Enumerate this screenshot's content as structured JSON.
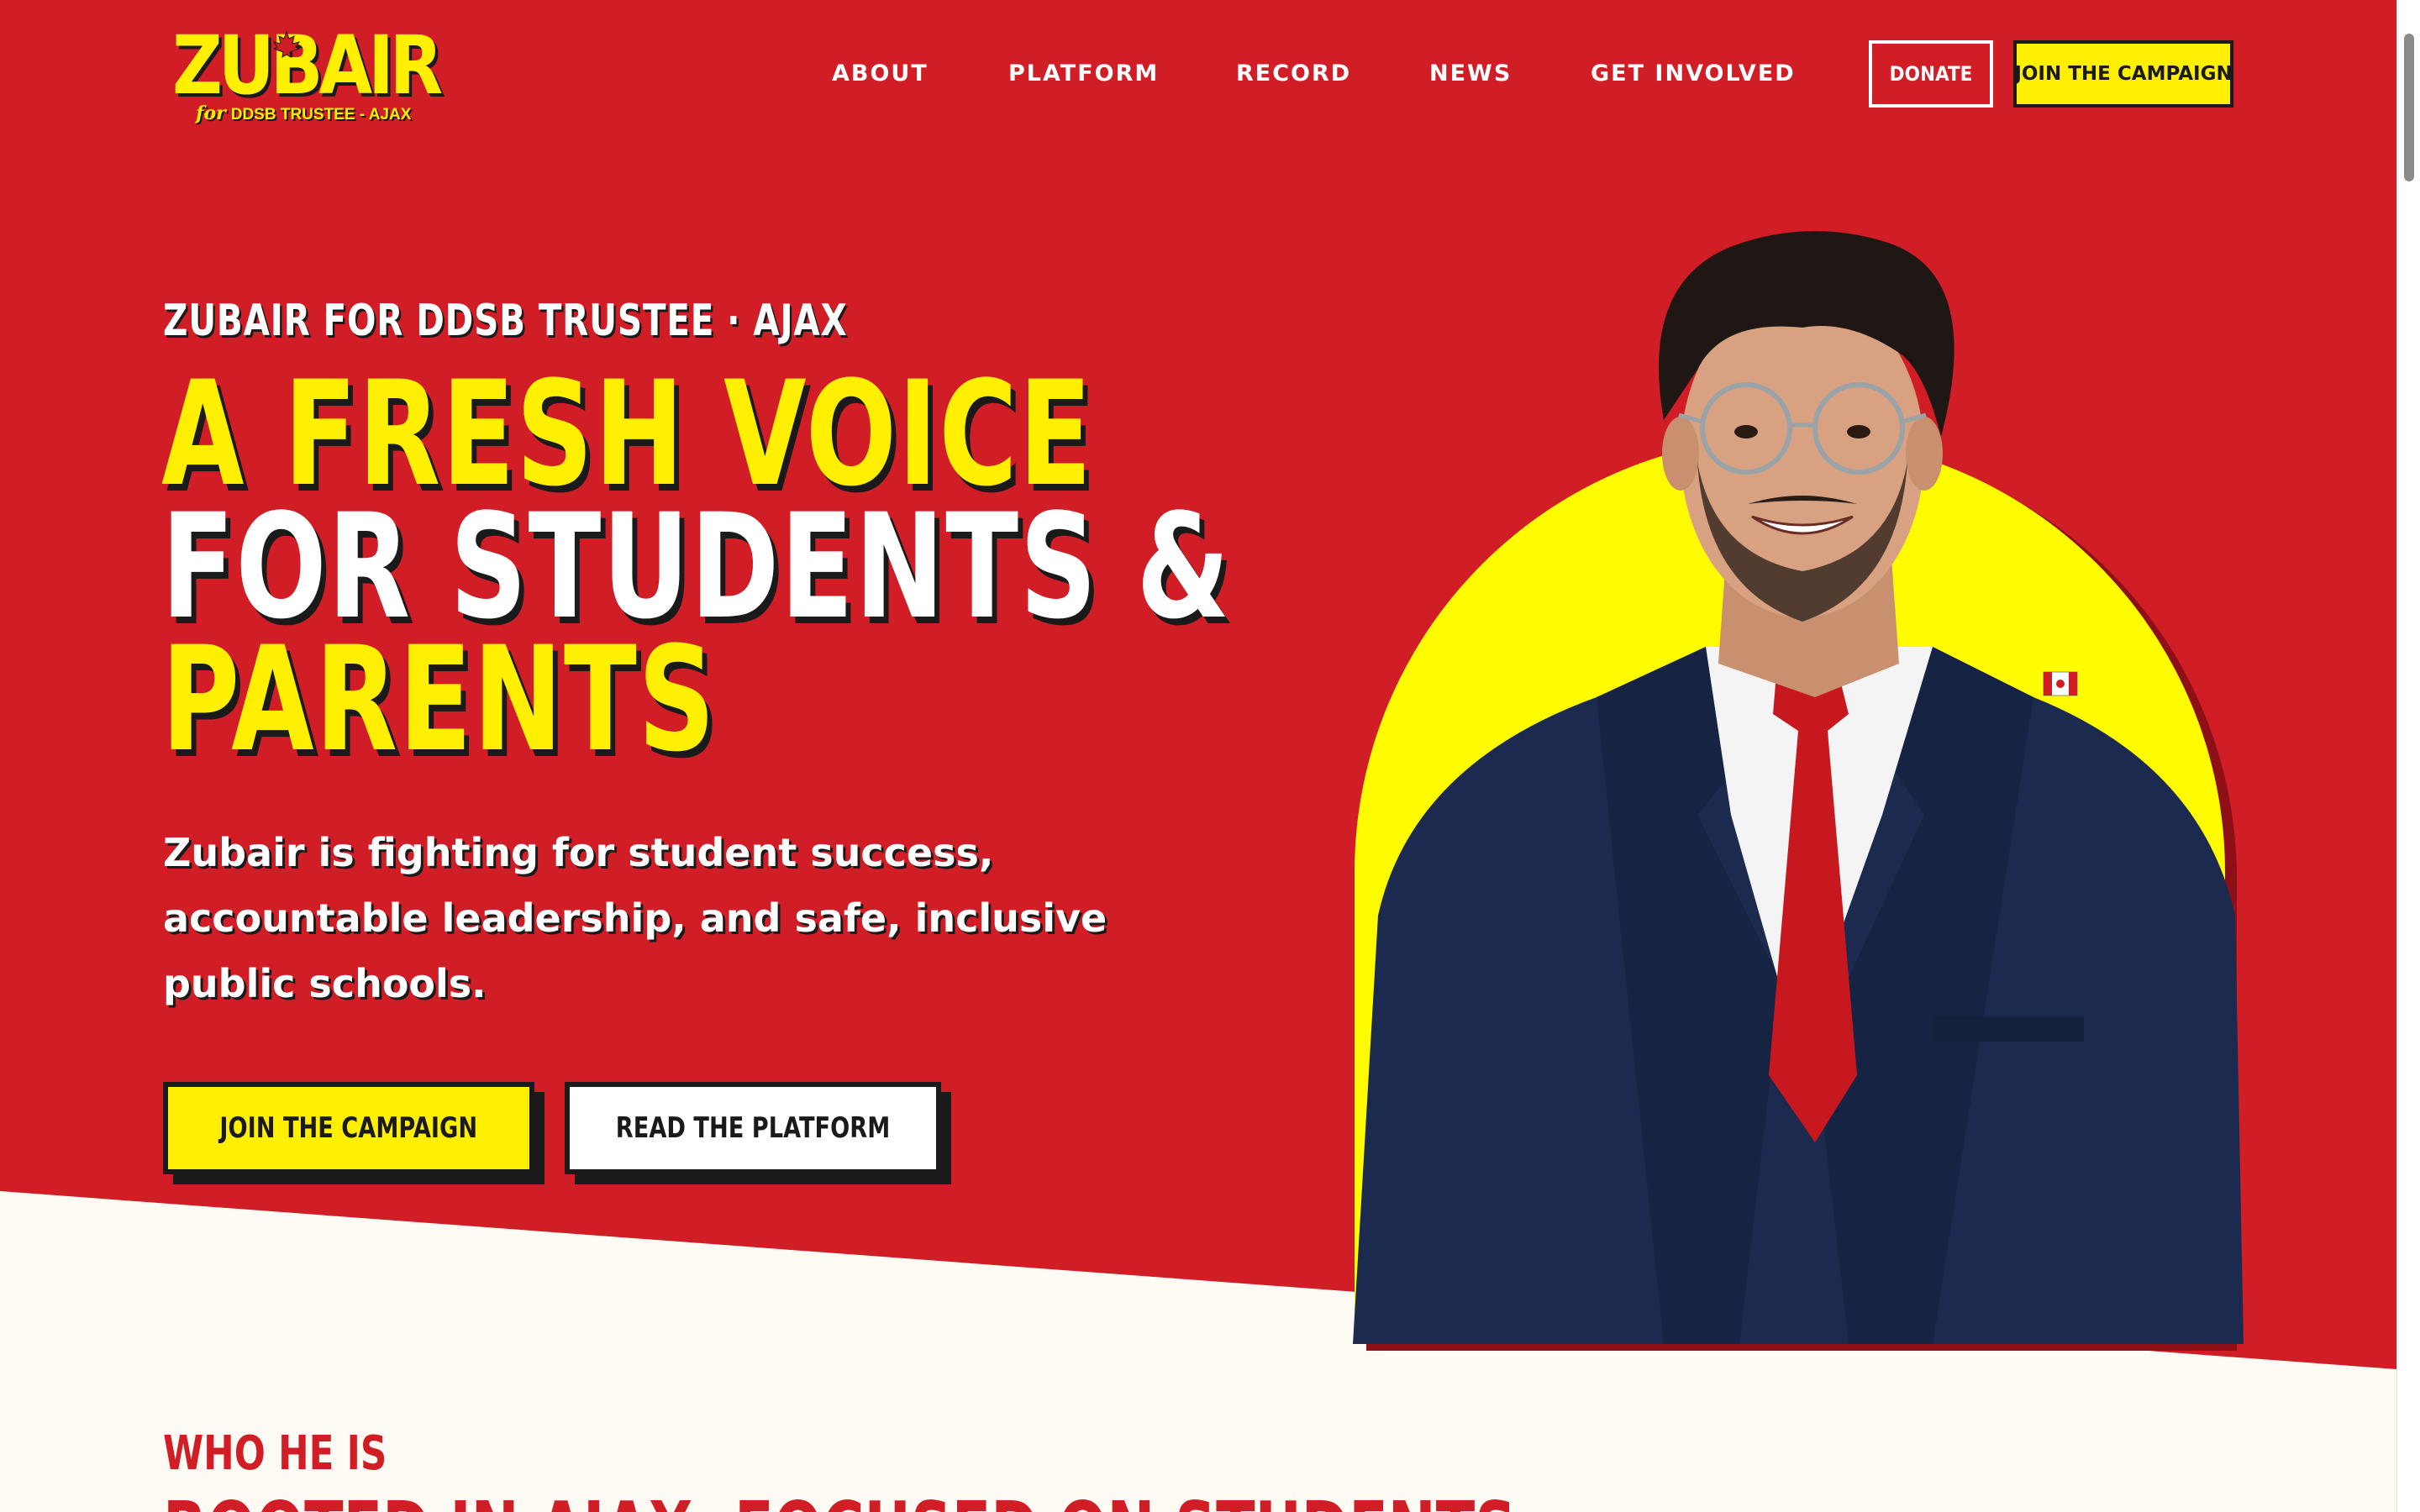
{
  "brand": {
    "logo_word": "ZUBAIR",
    "logo_for": "for",
    "logo_sub": "DDSB TRUSTEE - AJAX"
  },
  "nav": {
    "items": [
      {
        "label": "ABOUT"
      },
      {
        "label": "PLATFORM"
      },
      {
        "label": "RECORD"
      },
      {
        "label": "NEWS"
      },
      {
        "label": "GET INVOLVED"
      }
    ],
    "donate_label": "DONATE",
    "join_label": "JOIN THE CAMPAIGN"
  },
  "hero": {
    "kicker": "ZUBAIR FOR DDSB TRUSTEE · AJAX",
    "headline_line1": "A FRESH VOICE",
    "headline_line2": "FOR STUDENTS &",
    "headline_line3": "PARENTS",
    "lede": "Zubair is fighting for student success, accountable leadership, and safe, inclusive public schools.",
    "cta_primary": "JOIN THE CAMPAIGN",
    "cta_secondary": "READ THE PLATFORM"
  },
  "about": {
    "kicker": "WHO HE IS",
    "title": "ROOTED IN AJAX. FOCUSED ON STUDENTS."
  },
  "colors": {
    "brand_red": "#d01d26",
    "brand_yellow": "#ffef00",
    "ink": "#1a1a1a",
    "cream": "#fdfbf4",
    "suit_navy": "#1c2a4f"
  },
  "icons": {
    "logo_leaf": "maple-leaf-icon",
    "lapel_pin": "canada-flag-icon"
  }
}
